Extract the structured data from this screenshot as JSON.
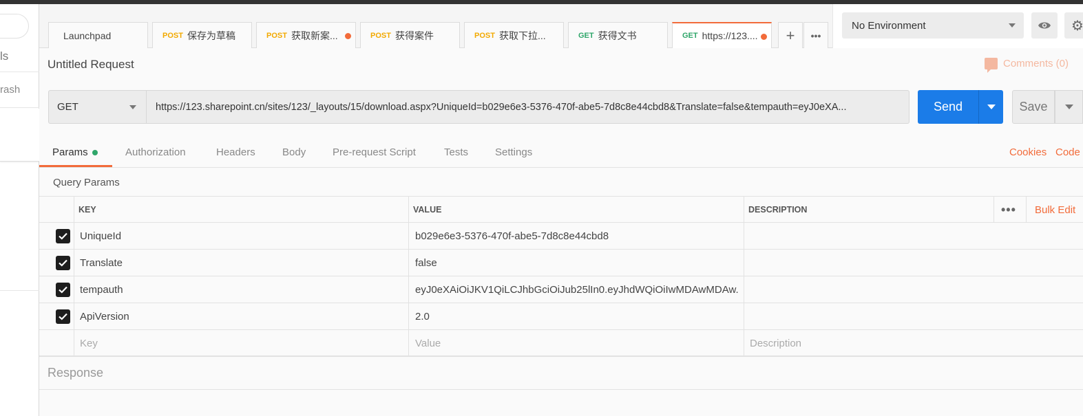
{
  "sidebar": {
    "partial_label_1": "ls",
    "trash_label": "rash"
  },
  "tabs": [
    {
      "method": "",
      "label": "Launchpad"
    },
    {
      "method": "POST",
      "label": "保存为草稿"
    },
    {
      "method": "POST",
      "label": "获取新案...",
      "unsaved": true
    },
    {
      "method": "POST",
      "label": "获得案件"
    },
    {
      "method": "POST",
      "label": "获取下拉..."
    },
    {
      "method": "GET",
      "label": "获得文书"
    },
    {
      "method": "GET",
      "label": "https://123....",
      "active": true,
      "unsaved": true
    }
  ],
  "tab_actions": {
    "add": "+",
    "more": "•••"
  },
  "environment": {
    "selected": "No Environment"
  },
  "request": {
    "title": "Untitled Request",
    "comments_label": "Comments (0)",
    "method": "GET",
    "url": "https://123.sharepoint.cn/sites/123/_layouts/15/download.aspx?UniqueId=b029e6e3-5376-470f-abe5-7d8c8e44cbd8&Translate=false&tempauth=eyJ0eXA...",
    "send_label": "Send",
    "save_label": "Save"
  },
  "request_tabs": [
    "Params",
    "Authorization",
    "Headers",
    "Body",
    "Pre-request Script",
    "Tests",
    "Settings"
  ],
  "request_links": {
    "cookies": "Cookies",
    "code": "Code"
  },
  "query_params": {
    "title": "Query Params",
    "columns": {
      "key": "KEY",
      "value": "VALUE",
      "description": "DESCRIPTION"
    },
    "bulk_edit": "Bulk Edit",
    "more": "•••",
    "rows": [
      {
        "key": "UniqueId",
        "value": "b029e6e3-5376-470f-abe5-7d8c8e44cbd8",
        "checked": true
      },
      {
        "key": "Translate",
        "value": "false",
        "checked": true
      },
      {
        "key": "tempauth",
        "value": "eyJ0eXAiOiJKV1QiLCJhbGciOiJub25lIn0.eyJhdWQiOiIwMDAwMDAw...",
        "checked": true
      },
      {
        "key": "ApiVersion",
        "value": "2.0",
        "checked": true
      }
    ],
    "placeholders": {
      "key": "Key",
      "value": "Value",
      "description": "Description"
    }
  },
  "response": {
    "label": "Response"
  },
  "colors": {
    "accent": "#f26b3a",
    "send": "#1b7ce8",
    "post": "#f2a900",
    "get": "#2fa66a"
  },
  "icons": [
    "search-icon",
    "eye-icon",
    "gear-icon",
    "plus-icon",
    "more-icon",
    "comment-icon",
    "checkbox-icon",
    "chevron-down-icon"
  ]
}
